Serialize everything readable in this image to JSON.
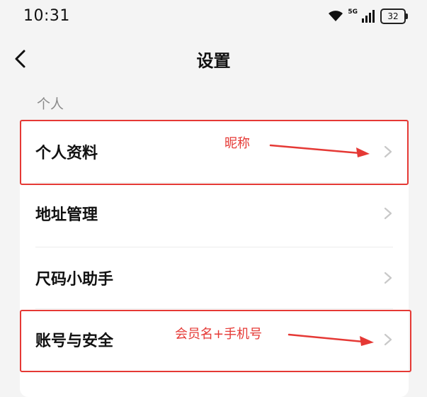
{
  "status_bar": {
    "time": "10:31",
    "network": "5G",
    "battery": "32"
  },
  "nav": {
    "title": "设置"
  },
  "section": {
    "label": "个人"
  },
  "rows": [
    {
      "label": "个人资料"
    },
    {
      "label": "地址管理"
    },
    {
      "label": "尺码小助手"
    },
    {
      "label": "账号与安全"
    }
  ],
  "annotations": {
    "profile_note": "昵称",
    "account_note": "会员名+手机号",
    "color": "#e53935"
  }
}
